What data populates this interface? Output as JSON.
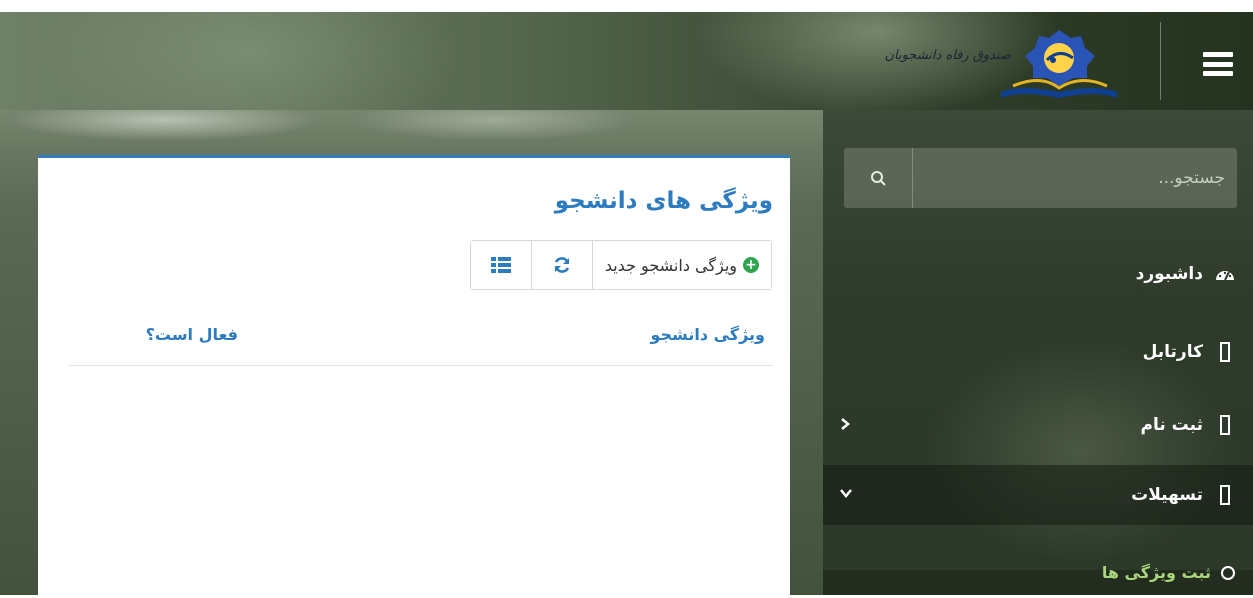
{
  "header": {
    "logo_text": "صندوق رفاه دانشجویان",
    "menu_icon": "hamburger-icon"
  },
  "sidebar": {
    "search": {
      "placeholder": "جستجو...",
      "icon": "search-icon"
    },
    "items": [
      {
        "label": "داشبورد",
        "icon": "dashboard-gauge-icon"
      },
      {
        "label": "کارتابل",
        "icon": "box-icon"
      },
      {
        "label": "ثبت نام",
        "icon": "box-icon",
        "chevron": "chevron-left-icon"
      },
      {
        "label": "تسهیلات",
        "icon": "box-icon",
        "chevron": "chevron-down-icon",
        "expanded": true
      }
    ],
    "submenu": [
      {
        "label": "ثبت ویژگی ها",
        "icon": "circle-icon",
        "active_color": "#a9d67c"
      }
    ]
  },
  "main": {
    "title": "ویژگی های دانشجو",
    "toolbar": {
      "new_label": "ویژگی دانشجو جدید",
      "refresh_icon": "refresh-icon",
      "list_icon": "list-icon"
    },
    "table": {
      "columns": [
        "ویژگی دانشجو",
        "فعال است؟"
      ]
    }
  },
  "colors": {
    "accent": "#2d7cc0",
    "add_green": "#2ea44f",
    "submenu_active": "#a9d67c"
  }
}
